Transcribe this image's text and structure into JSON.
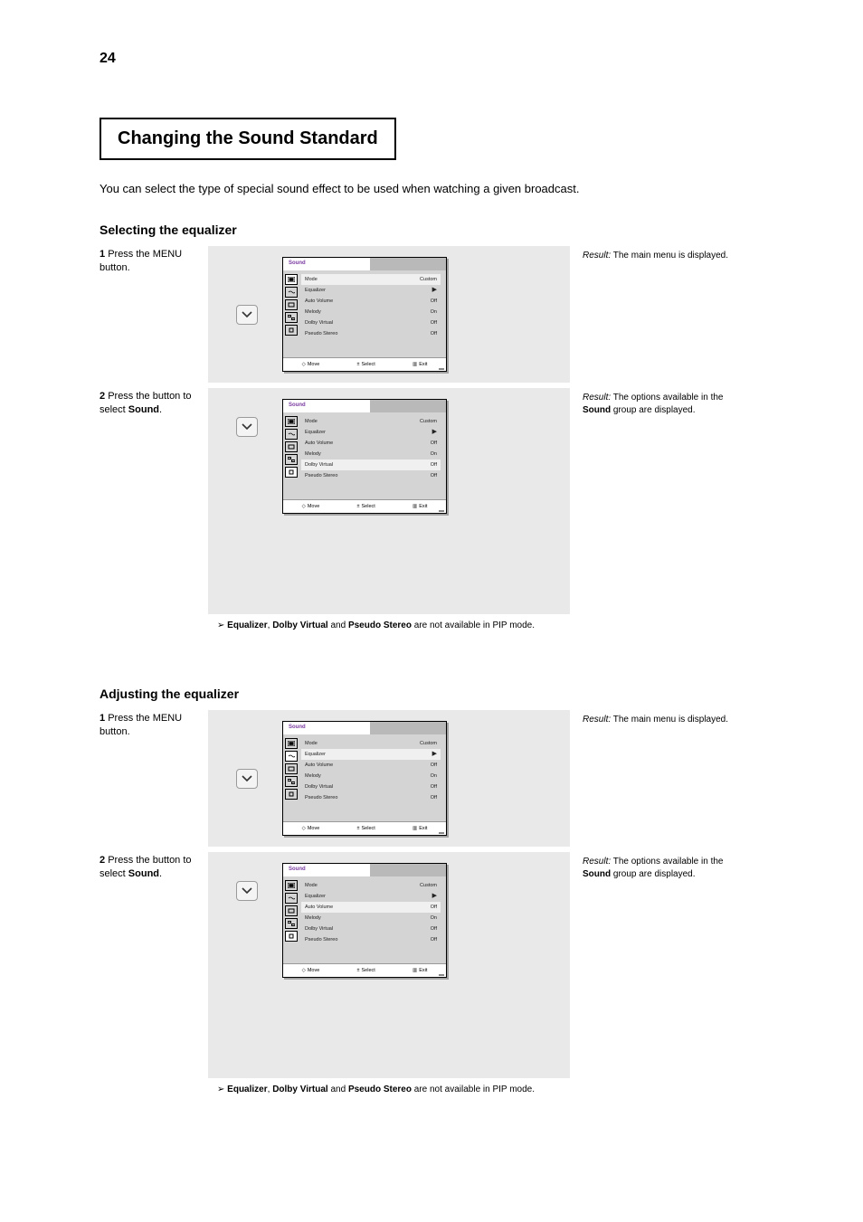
{
  "page": {
    "number": "24"
  },
  "section": {
    "box_title": "Changing the Sound Standard"
  },
  "body": {
    "intro": "You can select the type of special sound effect to be used when watching a given broadcast.",
    "equalizer_heading": "Selecting the equalizer",
    "step1": {
      "number": "1",
      "text": "Press the MENU button.",
      "result_label": "Result:",
      "result": "The main menu is displayed."
    },
    "step2": {
      "number": "2",
      "text_a": "Press the ",
      "text_b": " button to select ",
      "text_bold": "Sound",
      "text_c": ".",
      "result_label": "Result:",
      "result1": "The options available in the ",
      "result1_bold": "Sound",
      "result1_c": " group are displayed.",
      "note_prefix": "➢ ",
      "note_bold1": "Equalizer",
      "note_mid": ", ",
      "note_bold2": "Dolby Virtual",
      "note_and": " and ",
      "note_bold3": "Pseudo Stereo",
      "note_tail": " are not available in PIP mode."
    },
    "adjust_heading": "Adjusting the equalizer",
    "step3": {
      "number": "1",
      "text": "Press the MENU button.",
      "result_label": "Result:",
      "result": "The main menu is displayed."
    },
    "step4": {
      "number": "2",
      "text_a": "Press the ",
      "text_b": " button to select ",
      "text_bold": "Sound",
      "text_c": ".",
      "result_label": "Result:",
      "result1": "The options available in the ",
      "result1_bold": "Sound",
      "result1_c": " group are displayed.",
      "note_prefix": "➢ ",
      "note_bold1": "Equalizer",
      "note_mid": ", ",
      "note_bold2": "Dolby Virtual",
      "note_and": " and ",
      "note_bold3": "Pseudo Stereo",
      "note_tail": " are not available in PIP mode."
    }
  },
  "osd_common": {
    "title": "Sound",
    "menu": {
      "mode_label": "Mode",
      "mode_value": "Custom",
      "equalizer_label": "Equalizer",
      "auto_volume_label": "Auto Volume",
      "auto_volume_value": "Off",
      "melody_label": "Melody",
      "melody_value": "On",
      "dolby_label": "Dolby Virtual",
      "dolby_value": "Off",
      "pseudo_label": "Pseudo Stereo",
      "pseudo_value": "Off"
    },
    "footer": {
      "move": "Move",
      "select": "Select",
      "exit": "Exit"
    }
  }
}
